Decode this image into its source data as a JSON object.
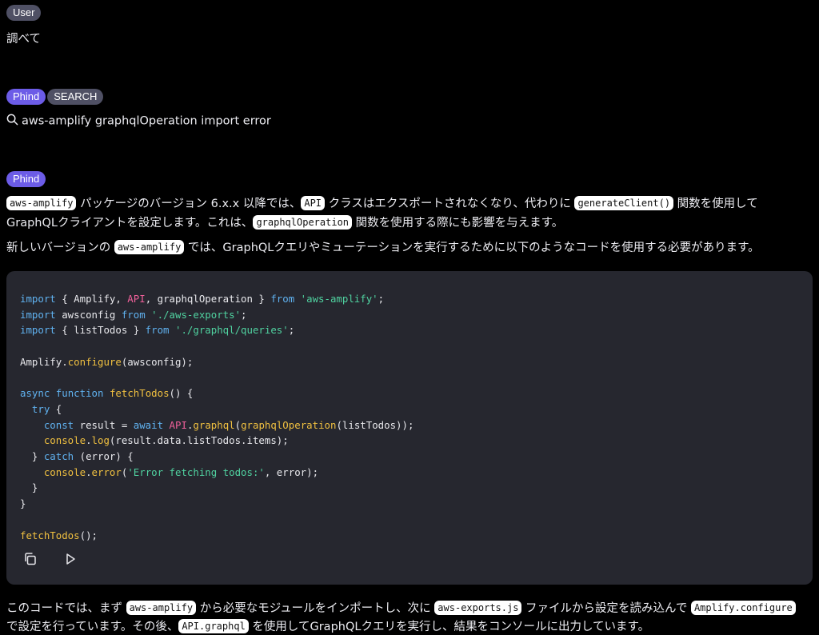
{
  "user": {
    "badge": "User",
    "message": "調べて"
  },
  "search": {
    "badge_phind": "Phind",
    "badge_search": "SEARCH",
    "query": "aws-amplify graphqlOperation import error"
  },
  "answer": {
    "badge": "Phind",
    "p1": {
      "code1": "aws-amplify",
      "t1": " パッケージのバージョン 6.x.x 以降では、",
      "code2": "API",
      "t2": " クラスはエクスポートされなくなり、代わりに ",
      "code3": "generateClient()",
      "t3": " 関数を使用して",
      "t4": "GraphQLクライアントを設定します。これは、",
      "code4": "graphqlOperation",
      "t5": " 関数を使用する際にも影響を与えます。"
    },
    "p2": {
      "t1": "新しいバージョンの ",
      "code1": "aws-amplify",
      "t2": " では、GraphQLクエリやミューテーションを実行するために以下のようなコードを使用する必要があります。"
    },
    "code_lines": [
      "import { Amplify, API, graphqlOperation } from 'aws-amplify';",
      "import awsconfig from './aws-exports';",
      "import { listTodos } from './graphql/queries';",
      "",
      "Amplify.configure(awsconfig);",
      "",
      "async function fetchTodos() {",
      "  try {",
      "    const result = await API.graphql(graphqlOperation(listTodos));",
      "    console.log(result.data.listTodos.items);",
      "  } catch (error) {",
      "    console.error('Error fetching todos:', error);",
      "  }",
      "}",
      "",
      "fetchTodos();"
    ],
    "p3": {
      "t1": "このコードでは、まず ",
      "code1": "aws-amplify",
      "t2": " から必要なモジュールをインポートし、次に ",
      "code2": "aws-exports.js",
      "t3": " ファイルから設定を読み込んで ",
      "code3": "Amplify.configure",
      "t4": "で設定を行っています。その後、",
      "code4": "API.graphql",
      "t5": " を使用してGraphQLクエリを実行し、結果をコンソールに出力しています。"
    }
  },
  "icons": {
    "copy": "copy-icon",
    "run": "play-icon",
    "search": "search-icon"
  },
  "colors": {
    "background": "#000000",
    "codebox": "#26272f",
    "phind_badge": "#6c5ce7",
    "user_badge": "#4f5064",
    "keyword": "#60b2f0",
    "string": "#50d2a0",
    "class": "#f0609a",
    "function": "#f0c040"
  }
}
